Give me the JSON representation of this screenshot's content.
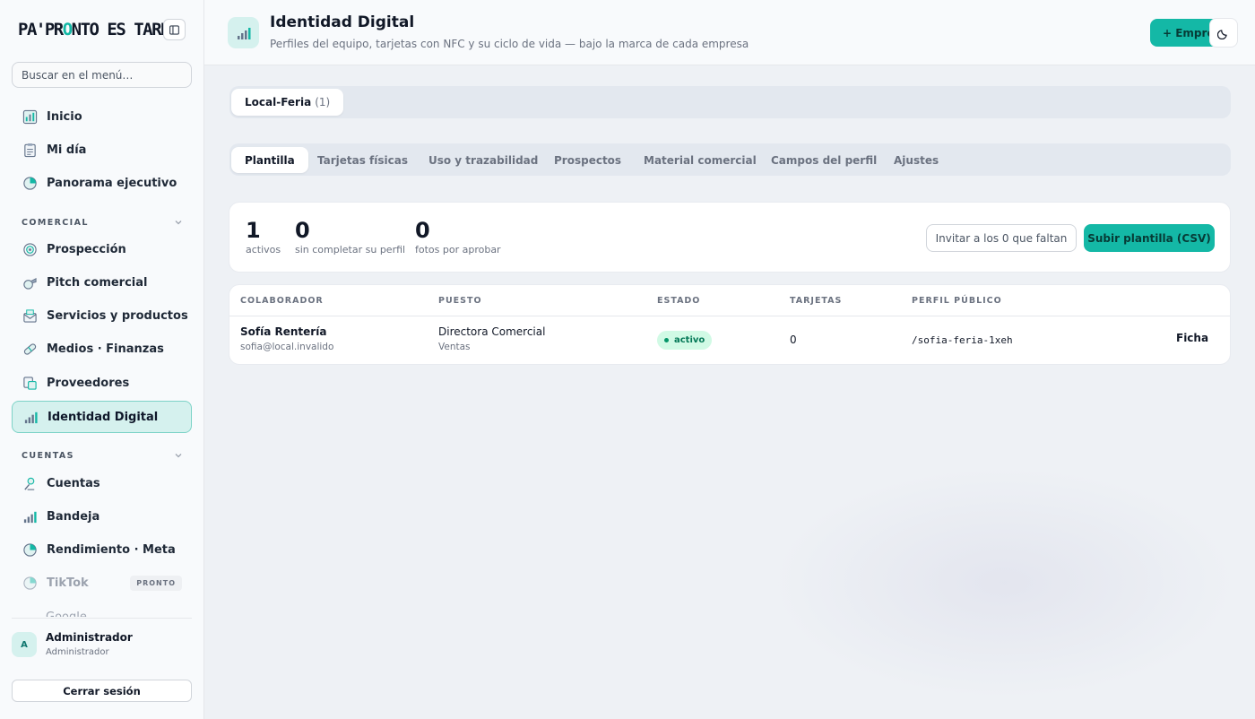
{
  "brand": {
    "logo_text": "PA'PRONTO ES TARDE",
    "accent": "#14b8a6"
  },
  "sidebar": {
    "search_placeholder": "Buscar en el menú…",
    "items_top": [
      {
        "label": "Inicio",
        "icon": "chart-board-icon"
      },
      {
        "label": "Mi día",
        "icon": "clipboard-icon"
      },
      {
        "label": "Panorama ejecutivo",
        "icon": "pie-chart-icon"
      }
    ],
    "section_comercial": "COMERCIAL",
    "items_comercial": [
      {
        "label": "Prospección",
        "icon": "target-icon"
      },
      {
        "label": "Pitch comercial",
        "icon": "whistle-icon"
      },
      {
        "label": "Servicios y productos",
        "icon": "envelope-open-icon"
      },
      {
        "label": "Medios · Finanzas",
        "icon": "pill-icon"
      },
      {
        "label": "Proveedores",
        "icon": "card-stack-icon"
      },
      {
        "label": "Identidad Digital",
        "icon": "signal-bars-icon",
        "active": true
      }
    ],
    "section_cuentas": "CUENTAS",
    "items_cuentas": [
      {
        "label": "Cuentas",
        "icon": "user-pin-icon"
      },
      {
        "label": "Bandeja",
        "icon": "signal-bars-icon"
      },
      {
        "label": "Rendimiento · Meta",
        "icon": "pie-chart-icon"
      },
      {
        "label": "TikTok",
        "icon": "pie-chart-icon",
        "badge": "PRONTO",
        "disabled": true
      }
    ],
    "partial_item": "Google",
    "user": {
      "initial": "A",
      "name": "Administrador",
      "role": "Administrador"
    },
    "logout": "Cerrar sesión"
  },
  "header": {
    "title": "Identidad Digital",
    "subtitle": "Perfiles del equipo, tarjetas con NFC y su ciclo de vida — bajo la marca de cada empresa",
    "new_company": "+ Empresa"
  },
  "company_tab": {
    "label": "Local-Feria",
    "count": "(1)"
  },
  "tabs": [
    "Plantilla",
    "Tarjetas físicas",
    "Uso y trazabilidad",
    "Prospectos",
    "Material comercial",
    "Campos del perfil",
    "Ajustes"
  ],
  "stats": [
    {
      "value": "1",
      "label": "activos"
    },
    {
      "value": "0",
      "label": "sin completar su perfil"
    },
    {
      "value": "0",
      "label": "fotos por aprobar"
    }
  ],
  "actions": {
    "invite": "Invitar a los 0 que faltan",
    "upload": "Subir plantilla (CSV)"
  },
  "table": {
    "headers": [
      "COLABORADOR",
      "PUESTO",
      "ESTADO",
      "TARJETAS",
      "PERFIL PÚBLICO"
    ],
    "rows": [
      {
        "name": "Sofía Rentería",
        "email": "sofia@local.invalido",
        "role": "Directora Comercial",
        "area": "Ventas",
        "status": "activo",
        "cards": "0",
        "profile": "/sofia-feria-1xeh",
        "action": "Ficha"
      }
    ]
  }
}
